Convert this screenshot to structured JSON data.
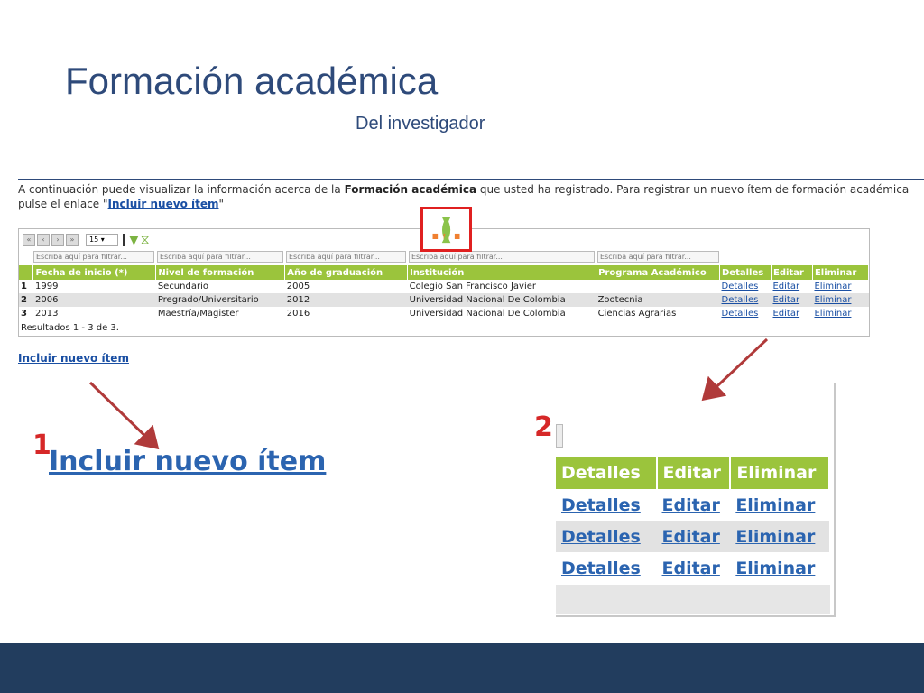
{
  "slide": {
    "title": "Formación académica",
    "subtitle": "Del investigador"
  },
  "intro": {
    "text_before": "A continuación puede visualizar la información acerca de la ",
    "bold": "Formación académica",
    "text_after": " que usted ha registrado. Para registrar un nuevo ítem de formación académica pulse el enlace \"",
    "link": "Incluir nuevo ítem",
    "text_end": "\""
  },
  "callout": {
    "paren_open": "(",
    "dots": "...",
    "paren_close": ")"
  },
  "grid": {
    "page_size": "15",
    "filter_placeholder": "Escriba aquí para filtrar...",
    "headers": [
      "",
      "Fecha de inicio (*)",
      "Nivel de formación",
      "Año de graduación",
      "Institución",
      "Programa Académico",
      "Detalles",
      "Editar",
      "Eliminar"
    ],
    "rows": [
      {
        "n": "1",
        "fecha": "1999",
        "nivel": "Secundario",
        "anio": "2005",
        "institucion": "Colegio San Francisco Javier",
        "programa": "",
        "detalles": "Detalles",
        "editar": "Editar",
        "eliminar": "Eliminar"
      },
      {
        "n": "2",
        "fecha": "2006",
        "nivel": "Pregrado/Universitario",
        "anio": "2012",
        "institucion": "Universidad Nacional De Colombia",
        "programa": "Zootecnia",
        "detalles": "Detalles",
        "editar": "Editar",
        "eliminar": "Eliminar"
      },
      {
        "n": "3",
        "fecha": "2013",
        "nivel": "Maestría/Magister",
        "anio": "2016",
        "institucion": "Universidad Nacional De Colombia",
        "programa": "Ciencias Agrarias",
        "detalles": "Detalles",
        "editar": "Editar",
        "eliminar": "Eliminar"
      }
    ],
    "footer": "Resultados 1 - 3 de 3."
  },
  "links": {
    "include_small": "Incluir nuevo ítem",
    "include_big": "Incluir nuevo ítem"
  },
  "labels": {
    "one": "1",
    "two": "2"
  },
  "zoom": {
    "headers": [
      "Detalles",
      "Editar",
      "Eliminar"
    ],
    "rows": [
      [
        "Detalles",
        "Editar",
        "Eliminar"
      ],
      [
        "Detalles",
        "Editar",
        "Eliminar"
      ],
      [
        "Detalles",
        "Editar",
        "Eliminar"
      ]
    ]
  },
  "colors": {
    "title_blue": "#2e4a7a",
    "header_green": "#9bc43c",
    "link_blue": "#1a4fa3",
    "callout_red": "#e02020",
    "arrow_red": "#b03a3a",
    "bottom_bar": "#223d5e"
  },
  "icons": [
    "first-page-icon",
    "prev-page-icon",
    "next-page-icon",
    "last-page-icon",
    "filter-icon",
    "clear-filter-icon"
  ]
}
